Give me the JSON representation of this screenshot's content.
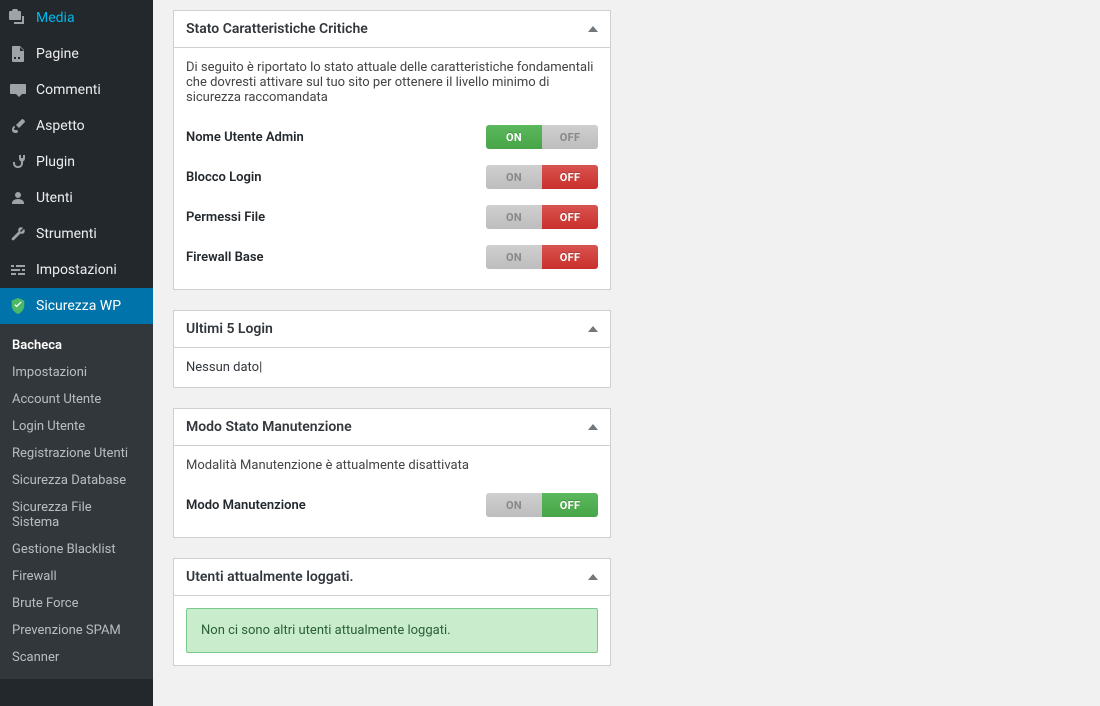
{
  "sidebar": {
    "items": [
      {
        "label": "Media",
        "icon": "media"
      },
      {
        "label": "Pagine",
        "icon": "page"
      },
      {
        "label": "Commenti",
        "icon": "comment"
      },
      {
        "label": "Aspetto",
        "icon": "brush"
      },
      {
        "label": "Plugin",
        "icon": "plug"
      },
      {
        "label": "Utenti",
        "icon": "user"
      },
      {
        "label": "Strumenti",
        "icon": "wrench"
      },
      {
        "label": "Impostazioni",
        "icon": "sliders"
      },
      {
        "label": "Sicurezza WP",
        "icon": "shield",
        "active": true
      }
    ],
    "submenu": [
      {
        "label": "Bacheca",
        "current": true
      },
      {
        "label": "Impostazioni"
      },
      {
        "label": "Account Utente"
      },
      {
        "label": "Login Utente"
      },
      {
        "label": "Registrazione Utenti"
      },
      {
        "label": "Sicurezza Database"
      },
      {
        "label": "Sicurezza File Sistema"
      },
      {
        "label": "Gestione Blacklist"
      },
      {
        "label": "Firewall"
      },
      {
        "label": "Brute Force"
      },
      {
        "label": "Prevenzione SPAM"
      },
      {
        "label": "Scanner"
      }
    ]
  },
  "panels": {
    "critical": {
      "title": "Stato Caratteristiche Critiche",
      "desc": "Di seguito è riportato lo stato attuale delle caratteristiche fondamentali che dovresti attivare sul tuo sito per ottenere il livello minimo di sicurezza raccomandata",
      "features": [
        {
          "label": "Nome Utente Admin",
          "state": "on"
        },
        {
          "label": "Blocco Login",
          "state": "off"
        },
        {
          "label": "Permessi File",
          "state": "off"
        },
        {
          "label": "Firewall Base",
          "state": "off"
        }
      ]
    },
    "lastLogins": {
      "title": "Ultimi 5 Login",
      "empty": "Nessun dato|"
    },
    "maintenance": {
      "title": "Modo Stato Manutenzione",
      "desc": "Modalità Manutenzione è attualmente disattivata",
      "feature": {
        "label": "Modo Manutenzione",
        "state": "off-green"
      }
    },
    "loggedUsers": {
      "title": "Utenti attualmente loggati.",
      "notice": "Non ci sono altri utenti attualmente loggati."
    }
  },
  "toggleLabels": {
    "on": "ON",
    "off": "OFF"
  }
}
